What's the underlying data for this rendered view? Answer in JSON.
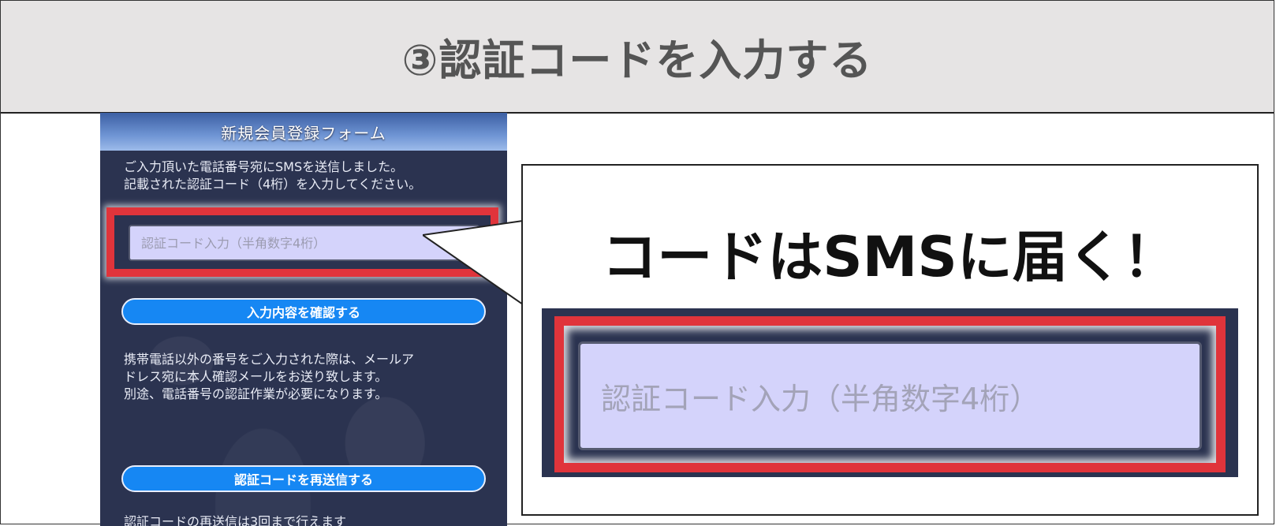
{
  "header": {
    "title": "③認証コードを入力する"
  },
  "phone": {
    "form_title": "新規会員登録フォーム",
    "instruction": "ご入力頂いた電話番号宛にSMSを送信しました。\n記載された認証コード（4桁）を入力してください。",
    "code_input": {
      "placeholder": "認証コード入力（半角数字4桁）",
      "value": ""
    },
    "confirm_button": "入力内容を確認する",
    "notice": "携帯電話以外の番号をご入力された際は、メールア\nドレス宛に本人確認メールをお送り致します。\n別途、電話番号の認証作業が必要になります。",
    "resend_button": "認証コードを再送信する",
    "bottom_text": "認証コードの再送信は3回まで行えます"
  },
  "callout": {
    "text": "コードはSMSに届く！",
    "zoom_input_placeholder": "認証コード入力（半角数字4桁）"
  },
  "colors": {
    "highlight_red": "#e0343b",
    "button_blue": "#1687f3",
    "input_bg": "#d4d3fb",
    "panel_bg": "#2b3350",
    "header_bg": "#e6e4e4"
  }
}
